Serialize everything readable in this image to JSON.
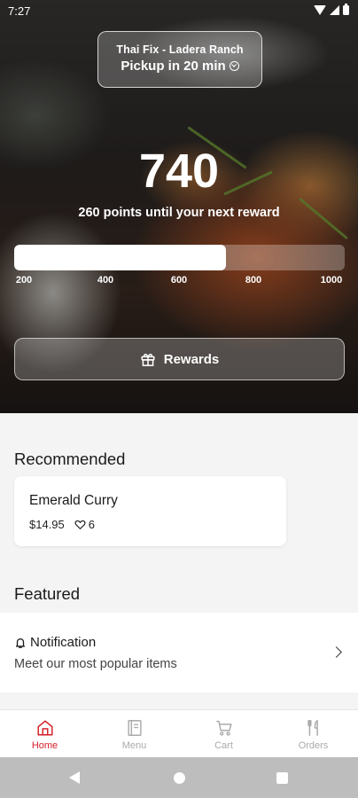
{
  "status_bar": {
    "time": "7:27"
  },
  "location": {
    "name": "Thai Fix - Ladera Ranch",
    "pickup": "Pickup in 20 min"
  },
  "rewards": {
    "points": "740",
    "subtitle": "260 points until your next reward",
    "progress_fraction": 0.64,
    "ticks": [
      "200",
      "400",
      "600",
      "800",
      "1000"
    ],
    "button_label": "Rewards"
  },
  "recommended": {
    "title": "Recommended",
    "items": [
      {
        "name": "Emerald Curry",
        "price": "$14.95",
        "likes": "6"
      }
    ]
  },
  "featured": {
    "title": "Featured",
    "items": [
      {
        "title": "Notification",
        "description": "Meet our most popular items"
      }
    ]
  },
  "tabs": [
    {
      "label": "Home",
      "icon": "home-icon",
      "active": true
    },
    {
      "label": "Menu",
      "icon": "menu-book-icon",
      "active": false
    },
    {
      "label": "Cart",
      "icon": "cart-icon",
      "active": false
    },
    {
      "label": "Orders",
      "icon": "fork-knife-icon",
      "active": false
    }
  ],
  "colors": {
    "accent": "#d6202a",
    "inactive_tab": "#aaaaaa",
    "nav_bar": "#bdbdbd"
  }
}
